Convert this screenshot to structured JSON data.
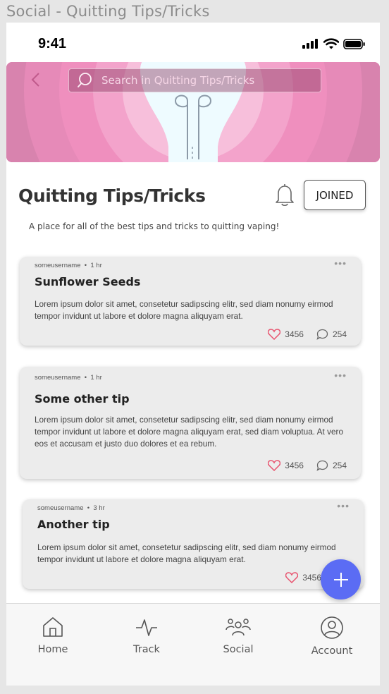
{
  "frame_title": "Social - Quitting Tips/Tricks",
  "status_bar": {
    "time": "9:41"
  },
  "search": {
    "placeholder": "Search in Quitting Tips/Tricks"
  },
  "community": {
    "title": "Quitting Tips/Tricks",
    "joined_label": "JOINED",
    "description": "A place for all of the best tips and tricks to quitting vaping!"
  },
  "posts": [
    {
      "author": "someusername",
      "time": "1 hr",
      "title": "Sunflower Seeds",
      "body": "Lorem ipsum dolor sit amet, consetetur sadipscing elitr, sed diam nonumy eirmod tempor invidunt ut labore et dolore magna aliquyam erat.",
      "likes": "3456",
      "comments": "254"
    },
    {
      "author": "someusername",
      "time": "1 hr",
      "title": "Some other tip",
      "body": "Lorem ipsum dolor sit amet, consetetur sadipscing elitr, sed diam nonumy eirmod tempor invidunt ut labore et dolore magna aliquyam erat, sed diam voluptua. At vero eos et accusam et justo duo dolores et ea rebum.",
      "likes": "3456",
      "comments": "254"
    },
    {
      "author": "someusername",
      "time": "3 hr",
      "title": "Another tip",
      "body": "Lorem ipsum dolor sit amet, consetetur sadipscing elitr, sed diam nonumy eirmod tempor invidunt ut labore et dolore magna aliquyam erat.",
      "likes": "3456"
    }
  ],
  "tabs": [
    {
      "label": "Home",
      "icon": "home-icon"
    },
    {
      "label": "Track",
      "icon": "activity-icon"
    },
    {
      "label": "Social",
      "icon": "people-icon"
    },
    {
      "label": "Account",
      "icon": "account-icon"
    }
  ],
  "colors": {
    "hero_pink": "#d883ae",
    "fab_blue": "#5b6cf4",
    "heart_red": "#e8546f"
  }
}
